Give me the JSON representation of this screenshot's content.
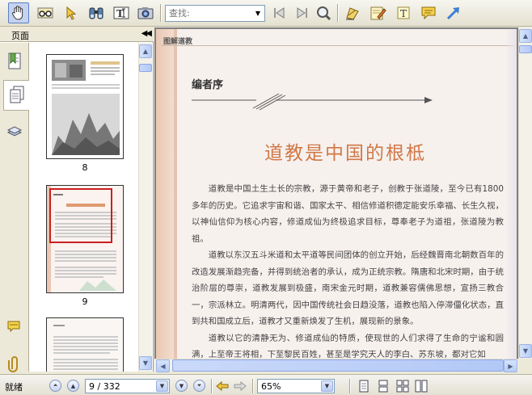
{
  "toolbar": {
    "search_placeholder": "查找:"
  },
  "left_panel": {
    "title": "页面",
    "thumbnails": [
      {
        "label": "8"
      },
      {
        "label": "9"
      },
      {
        "label": ""
      }
    ]
  },
  "document": {
    "header_text": "图解道教",
    "section_title": "编者序",
    "main_title": "道教是中国的根柢",
    "paragraphs": [
      "道教是中国土生土长的宗教，源于黄帝和老子，创教于张道陵，至今已有1800多年的历史。它追求宇宙和谐、国家太平、相信修道积德定能安乐幸福、长生久视，以神仙信仰为核心内容，修道成仙为终极追求目标，尊奉老子为道祖，张道陵为教祖。",
      "道教以东汉五斗米道和太平道等民间团体的创立开始，后经魏晋南北朝数百年的改造发展渐趋完备，并得到统治者的承认，成为正统宗教。隋唐和北宋时期，由于统治阶层的尊崇，道教发展到极盛，南宋金元时期，道教兼容儒佛思想，宣扬三教合一，宗派林立。明清两代，因中国传统社会日趋没落，道教也陷入停滞僵化状态，直到共和国成立后，道教才又重新焕发了生机，展现新的景象。",
      "道教以它的清静无为、修道成仙的特质，使现世的人们求得了生命的宁谧和圆满，上至帝王将相，下至黎民百姓，甚至是学究天人的李白、苏东坡，都对它如"
    ]
  },
  "statusbar": {
    "status": "就绪",
    "page_indicator": "9 / 332",
    "zoom": "65%"
  },
  "colors": {
    "title_accent": "#d07847",
    "selection_blue": "#5b7fc7"
  }
}
